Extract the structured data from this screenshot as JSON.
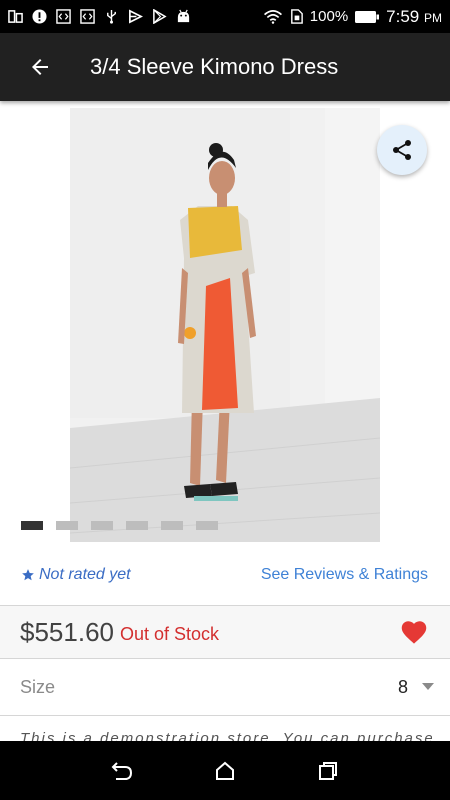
{
  "status_bar": {
    "battery": "100%",
    "time": "7:59",
    "ampm": "PM",
    "icons": [
      "apps-icon",
      "alert-icon",
      "code-icon",
      "code-icon",
      "usb-icon",
      "flag-icon",
      "play-store-icon",
      "android-icon",
      "wifi-icon",
      "sim-icon",
      "battery-icon"
    ]
  },
  "app_bar": {
    "title": "3/4 Sleeve Kimono Dress",
    "back_icon": "arrow-back-icon"
  },
  "product": {
    "image_description_icon": "product-photo",
    "share_icon": "share-icon",
    "image_count": 6,
    "active_image": 1
  },
  "rating": {
    "star_icon": "star-icon",
    "text": "Not rated yet",
    "reviews_link": "See Reviews & Ratings"
  },
  "price": {
    "amount": "$551.60",
    "stock_status": "Out of Stock",
    "favorite_icon": "heart-icon"
  },
  "size": {
    "label": "Size",
    "value": "8"
  },
  "description": {
    "text": "This is a demonstration store. You can purchase"
  },
  "colors": {
    "accent_blue": "#3f82d6",
    "out_of_stock": "#d32f2f",
    "heart": "#e53935",
    "app_bar": "#212121"
  },
  "nav_bar": {
    "icons": [
      "back-nav-icon",
      "home-nav-icon",
      "recents-nav-icon"
    ]
  }
}
